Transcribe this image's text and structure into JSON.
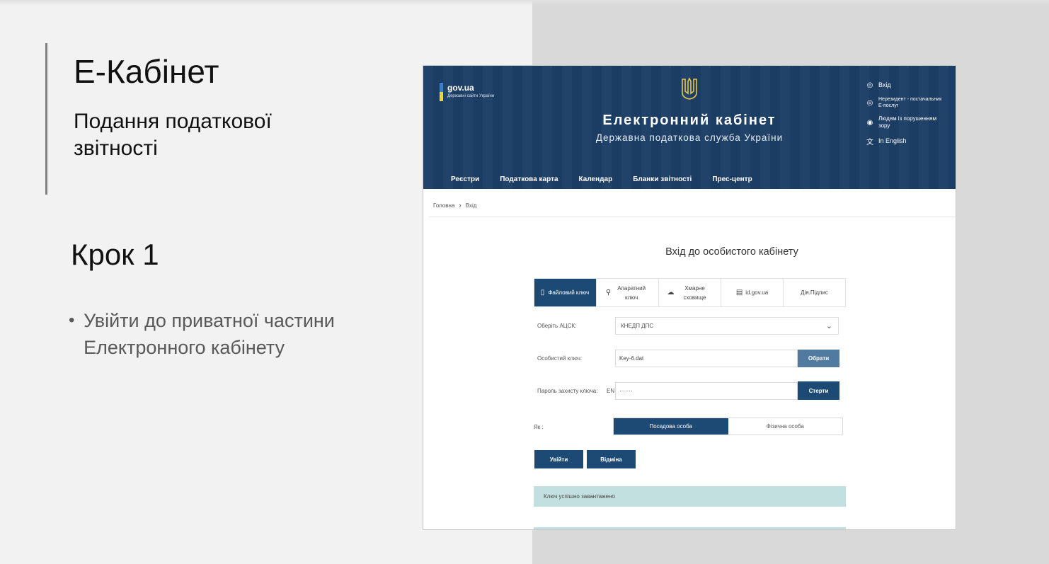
{
  "slide": {
    "title": "Е-Кабінет",
    "subtitle": "Подання податкової звітності",
    "step": "Крок 1",
    "bullet": "Увійти до приватної частини Електронного кабінету"
  },
  "site": {
    "gov_name": "gov.ua",
    "gov_sub": "Державні сайти України",
    "title": "Електронний кабінет",
    "subtitle": "Державна податкова служба України",
    "links": [
      {
        "icon": "login-icon",
        "label": "Вхід"
      },
      {
        "icon": "nonresident-icon",
        "label": "Нерезидент - постачальник Е-послуг"
      },
      {
        "icon": "eye-icon",
        "label": "Людям із порушенням зору"
      },
      {
        "icon": "translate-icon",
        "label": "In English"
      }
    ],
    "nav": [
      "Реєстри",
      "Податкова карта",
      "Календар",
      "Бланки звітності",
      "Прес-центр"
    ],
    "breadcrumb": [
      "Головна",
      "Вхід"
    ]
  },
  "login": {
    "title": "Вхід до особистого кабінету",
    "tabs": [
      {
        "icon": "file-icon",
        "label": "Файловий ключ",
        "active": true
      },
      {
        "icon": "key-icon",
        "label": "Апаратний ключ",
        "active": false
      },
      {
        "icon": "cloud-icon",
        "label": "Хмарне сховище",
        "active": false
      },
      {
        "icon": "id-icon",
        "label": "id.gov.ua",
        "active": false
      },
      {
        "icon": "",
        "label": "Дія.Підпис",
        "active": false
      }
    ],
    "acsk_label": "Оберіть АЦСК:",
    "acsk_value": "КНЕДП ДПС",
    "key_label": "Особистий ключ:",
    "key_value": "Key-6.dat",
    "choose_button": "Обрати",
    "password_label": "Пароль захисту ключа:",
    "password_lang": "EN",
    "password_value": "·······",
    "clear_button": "Стерти",
    "as_label": "Як :",
    "roles": [
      {
        "label": "Посадова особа",
        "selected": true
      },
      {
        "label": "Фізична особа",
        "selected": false
      }
    ],
    "login_button": "Увійти",
    "cancel_button": "Відміна",
    "alert": "Ключ успішно завантажено"
  },
  "colors": {
    "header": "#1d3f66",
    "accent": "#1c4a74",
    "alert": "#c3e0e0"
  }
}
